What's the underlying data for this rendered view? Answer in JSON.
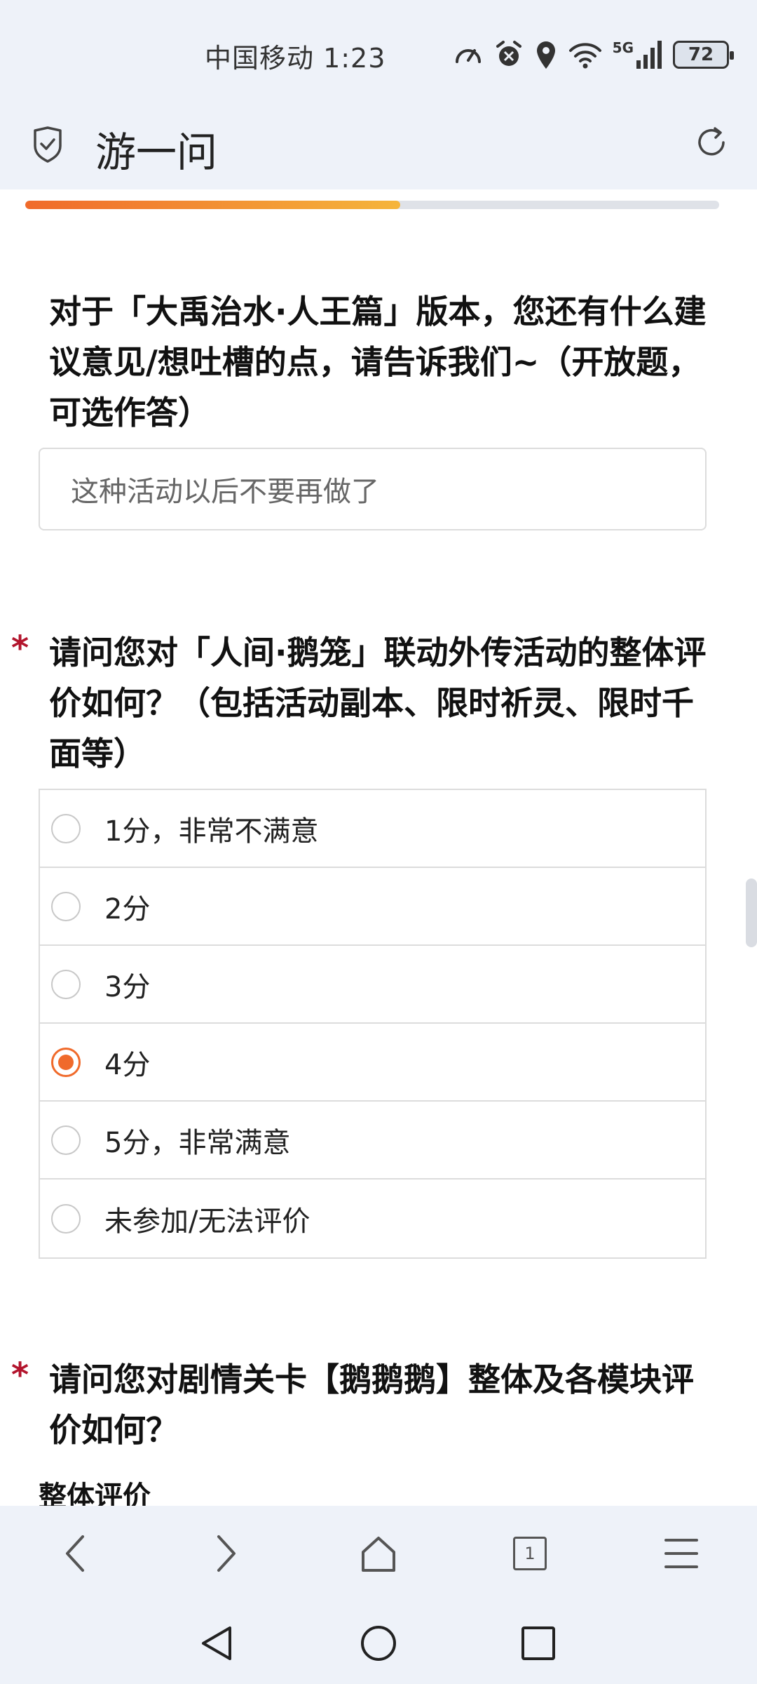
{
  "status": {
    "carrier_time": "中国移动 1:23",
    "network": "5G",
    "battery": "72"
  },
  "header": {
    "title": "游一问"
  },
  "progress": {
    "fraction": 0.54
  },
  "q1": {
    "text": "对于「大禹治水·人王篇」版本，您还有什么建议意见/想吐槽的点，请告诉我们~（开放题，可选作答）",
    "answer": "这种活动以后不要再做了"
  },
  "q2": {
    "required_mark": "*",
    "text": "请问您对「人间·鹅笼」联动外传活动的整体评价如何？（包括活动副本、限时祈灵、限时千面等）",
    "options": [
      {
        "label": "1分，非常不满意",
        "checked": false
      },
      {
        "label": "2分",
        "checked": false
      },
      {
        "label": "3分",
        "checked": false
      },
      {
        "label": "4分",
        "checked": true
      },
      {
        "label": "5分，非常满意",
        "checked": false
      },
      {
        "label": "未参加/无法评价",
        "checked": false
      }
    ]
  },
  "q3": {
    "required_mark": "*",
    "text": "请问您对剧情关卡【鹅鹅鹅】整体及各模块评价如何？",
    "sub_label": "整体评价"
  },
  "browser_nav": {
    "tab_count": "1"
  },
  "colors": {
    "accent": "#f06a2b",
    "required": "#b3152d",
    "bar_bg": "#eef2f9"
  }
}
